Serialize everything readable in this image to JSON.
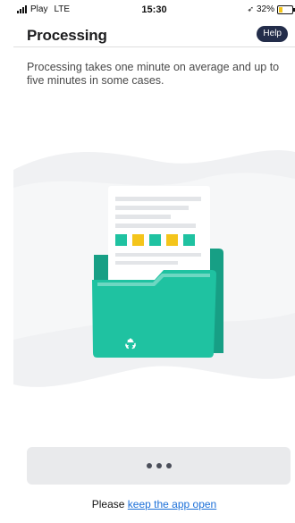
{
  "status_bar": {
    "carrier": "Play",
    "network": "LTE",
    "time": "15:30",
    "battery": "32%",
    "battery_level": 0.32
  },
  "nav": {
    "title": "Processing",
    "help_label": "Help"
  },
  "body": {
    "message": "Processing takes one minute on average and up to five minutes in some cases."
  },
  "colors": {
    "folder": "#1fc2a1",
    "folder_dark": "#179f85",
    "accent_yellow": "#f4c51b",
    "help_bg": "#232d4a",
    "link": "#1b6fd8"
  },
  "footer": {
    "prefix": "Please ",
    "link_text": "keep the app open"
  }
}
